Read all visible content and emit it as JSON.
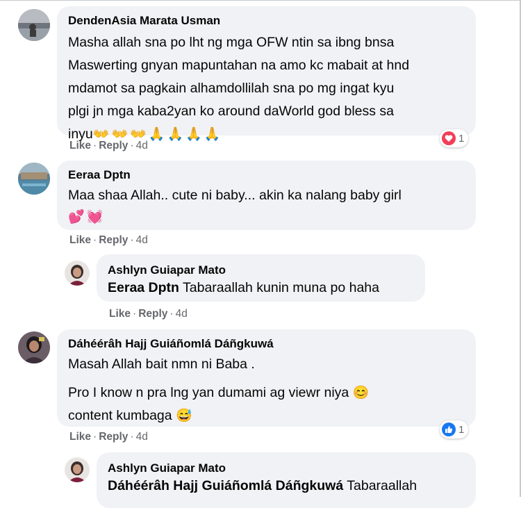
{
  "comments": [
    {
      "author": "DendenAsia Marata Usman",
      "lines": [
        "Masha allah sna po lht ng mga OFW ntin sa ibng bnsa",
        "Maswerting gnyan mapuntahan na amo kc mabait at hnd",
        "mdamot sa pagkain alhamdollilah sna po mg ingat kyu",
        "plgi jn mga kaba2yan ko around daWorld god bless sa",
        "inyu"
      ],
      "reaction": {
        "type": "heart-icon",
        "count": "1"
      },
      "actions": {
        "like": "Like",
        "reply": "Reply",
        "time": "4d"
      }
    },
    {
      "author": "Eeraa Dptn",
      "lines": [
        "Maa shaa Allah.. cute ni baby... akin ka nalang baby girl"
      ],
      "actions": {
        "like": "Like",
        "reply": "Reply",
        "time": "4d"
      },
      "reply": {
        "author": "Ashlyn Guiapar Mato",
        "mention": "Eeraa Dptn",
        "text": " Tabaraallah kunin muna po haha",
        "actions": {
          "like": "Like",
          "reply": "Reply",
          "time": "4d"
        }
      }
    },
    {
      "author": "Dáhéérâh Hajj Guiáñomlá Dáñgkuwá",
      "lines": [
        "Masah Allah bait nmn ni Baba .",
        "Pro I know n pra lng yan dumami ag viewr niya",
        "content kumbaga"
      ],
      "reaction": {
        "type": "like-icon",
        "count": "1"
      },
      "actions": {
        "like": "Like",
        "reply": "Reply",
        "time": "4d"
      },
      "reply": {
        "author": "Ashlyn Guiapar Mato",
        "mention": "Dáhéérâh Hajj Guiáñomlá Dáñgkuwá",
        "text": " Tabaraallah"
      }
    }
  ],
  "emoji": {
    "hands": "👐",
    "pray": "🙏",
    "hearts": "💕",
    "heart_beat": "💓",
    "smile": "😊",
    "sweat_smile": "😅"
  },
  "colors": {
    "bubble": "#f0f2f5",
    "meta": "#65676b",
    "heart": "#f33e58",
    "like": "#1877f2"
  }
}
